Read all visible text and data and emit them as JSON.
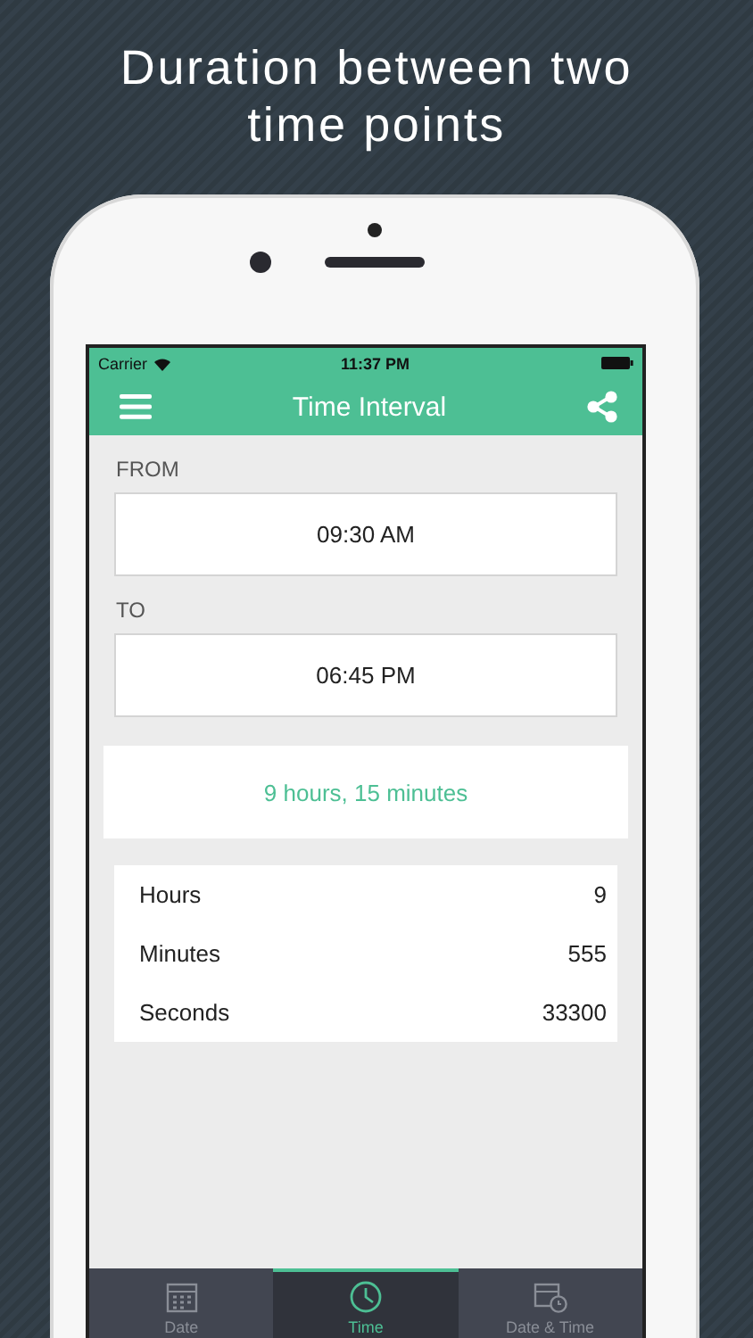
{
  "headline": "Duration between two time points",
  "status_bar": {
    "carrier": "Carrier",
    "time": "11:37 PM"
  },
  "nav_bar": {
    "title": "Time Interval"
  },
  "from": {
    "label": "FROM",
    "value": "09:30 AM"
  },
  "to": {
    "label": "TO",
    "value": "06:45 PM"
  },
  "result": "9 hours, 15 minutes",
  "breakdown": [
    {
      "unit": "Hours",
      "value": "9"
    },
    {
      "unit": "Minutes",
      "value": "555"
    },
    {
      "unit": "Seconds",
      "value": "33300"
    }
  ],
  "tabs": [
    {
      "label": "Date",
      "kind": "date",
      "selected": false
    },
    {
      "label": "Time",
      "kind": "time",
      "selected": true
    },
    {
      "label": "Date & Time",
      "kind": "datetime",
      "selected": false
    }
  ]
}
